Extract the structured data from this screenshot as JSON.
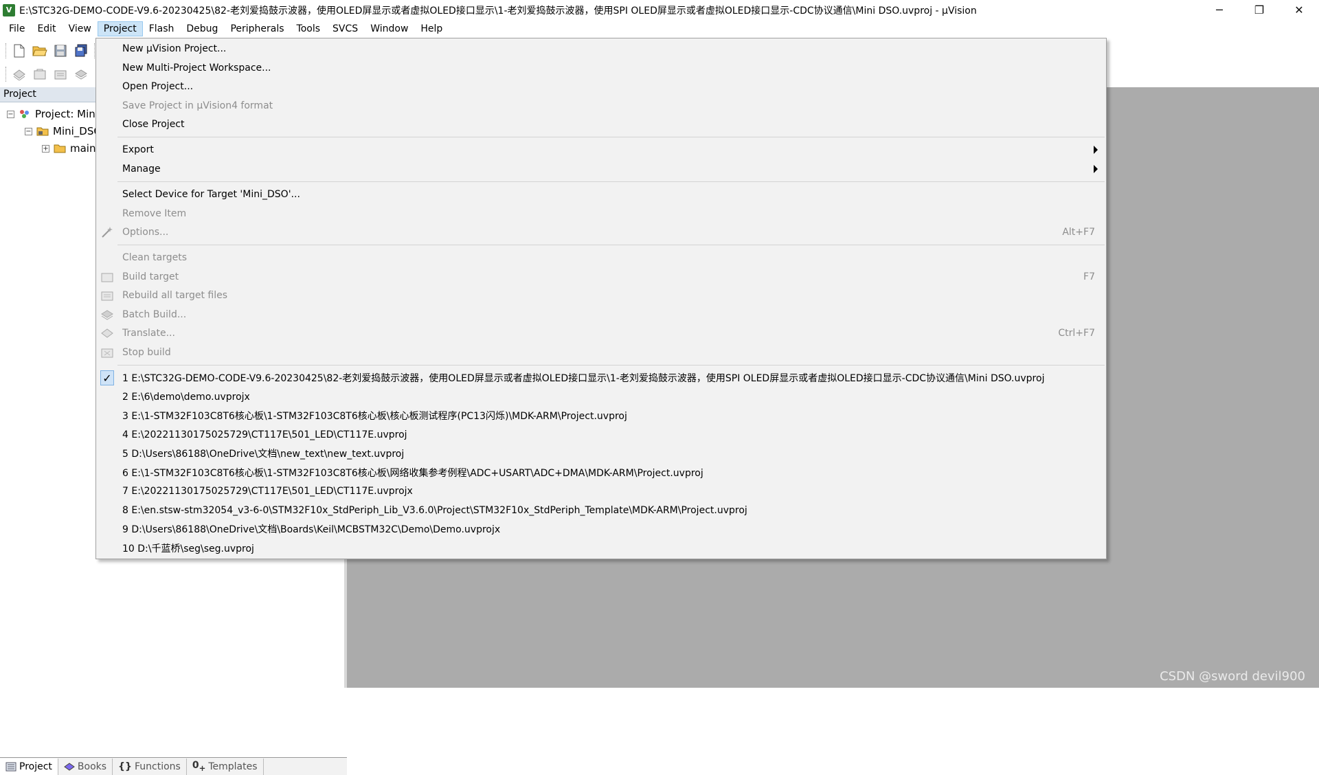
{
  "window": {
    "title": "E:\\STC32G-DEMO-CODE-V9.6-20230425\\82-老刘爱捣鼓示波器，使用OLED屏显示或者虚拟OLED接口显示\\1-老刘爱捣鼓示波器，使用SPI OLED屏显示或者虚拟OLED接口显示-CDC协议通信\\Mini DSO.uvproj - µVision",
    "icon_label": "V"
  },
  "menubar": [
    "File",
    "Edit",
    "View",
    "Project",
    "Flash",
    "Debug",
    "Peripherals",
    "Tools",
    "SVCS",
    "Window",
    "Help"
  ],
  "project_panel": {
    "header": "Project",
    "tree": [
      "Project: Mini",
      "Mini_DSO",
      "main"
    ],
    "tabs": [
      "Project",
      "Books",
      "Functions",
      "Templates"
    ]
  },
  "project_menu": {
    "group1": [
      "New µVision Project...",
      "New Multi-Project Workspace...",
      "Open Project...",
      "Save Project in µVision4 format",
      "Close Project"
    ],
    "group2": [
      "Export",
      "Manage"
    ],
    "group3": [
      "Select Device for Target 'Mini_DSO'...",
      "Remove Item",
      "Options..."
    ],
    "options_shortcut": "Alt+F7",
    "group4": [
      "Clean targets",
      "Build target",
      "Rebuild all target files",
      "Batch Build...",
      "Translate...",
      "Stop build"
    ],
    "build_shortcut": "F7",
    "translate_shortcut": "Ctrl+F7",
    "recent": [
      "1 E:\\STC32G-DEMO-CODE-V9.6-20230425\\82-老刘爱捣鼓示波器，使用OLED屏显示或者虚拟OLED接口显示\\1-老刘爱捣鼓示波器，使用SPI OLED屏显示或者虚拟OLED接口显示-CDC协议通信\\Mini DSO.uvproj",
      "2 E:\\6\\demo\\demo.uvprojx",
      "3 E:\\1-STM32F103C8T6核心板\\1-STM32F103C8T6核心板\\核心板测试程序(PC13闪烁)\\MDK-ARM\\Project.uvproj",
      "4 E:\\20221130175025729\\CT117E\\501_LED\\CT117E.uvproj",
      "5 D:\\Users\\86188\\OneDrive\\文档\\new_text\\new_text.uvproj",
      "6 E:\\1-STM32F103C8T6核心板\\1-STM32F103C8T6核心板\\网络收集参考例程\\ADC+USART\\ADC+DMA\\MDK-ARM\\Project.uvproj",
      "7 E:\\20221130175025729\\CT117E\\501_LED\\CT117E.uvprojx",
      "8 E:\\en.stsw-stm32054_v3-6-0\\STM32F10x_StdPeriph_Lib_V3.6.0\\Project\\STM32F10x_StdPeriph_Template\\MDK-ARM\\Project.uvproj",
      "9 D:\\Users\\86188\\OneDrive\\文档\\Boards\\Keil\\MCBSTM32C\\Demo\\Demo.uvprojx",
      "10 D:\\千蓝桥\\seg\\seg.uvproj"
    ],
    "checkmark": "✓"
  },
  "watermark": "CSDN @sword devil900",
  "colors": {
    "menu_bg": "#f2f2f2",
    "disabled": "#8d8d8d",
    "highlight": "#cce4f7",
    "editor_bg": "#ababab"
  }
}
